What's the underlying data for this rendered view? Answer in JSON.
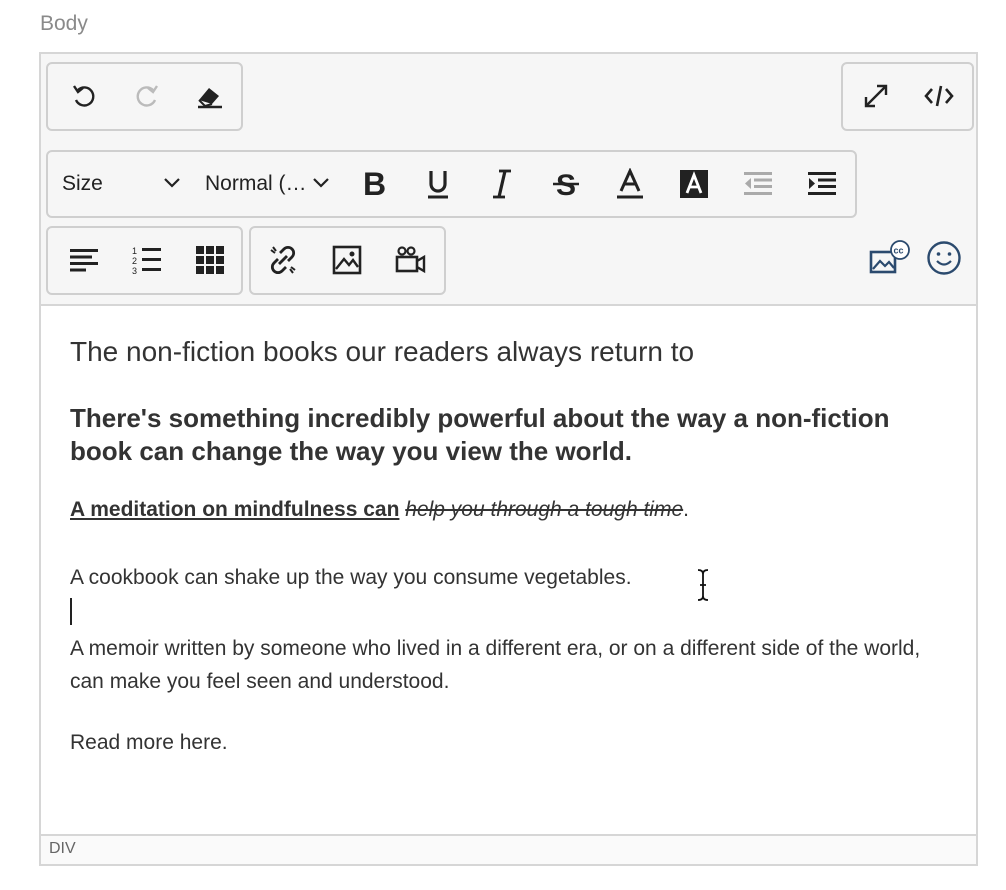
{
  "field_label": "Body",
  "toolbar": {
    "size_select": "Size",
    "format_select": "Normal (…",
    "buttons": [
      "undo",
      "redo",
      "clear-formatting",
      "fullscreen",
      "source-code",
      "bold",
      "underline",
      "italic",
      "strikethrough",
      "text-color",
      "background-color",
      "outdent",
      "indent",
      "align-left",
      "ordered-list",
      "table",
      "unlink",
      "insert-image",
      "insert-video",
      "image-cc",
      "emoji"
    ]
  },
  "content": {
    "heading": "The non-fiction books our readers always return to",
    "bold_paragraph": "There's something incredibly powerful about the way a non-fiction book can change the way you view the world.",
    "mindfulness_underlined": "A meditation on mindfulness can",
    "mindfulness_struck": "help you through a tough time",
    "mindfulness_end": ".",
    "cookbook": "A cookbook can shake up the way you consume vegetables.",
    "memoir": "A memoir written by someone who lived in a different era, or on a different side of the world, can make you feel seen and understood.",
    "read_more": "Read more here."
  },
  "statusbar": {
    "path": "DIV"
  }
}
